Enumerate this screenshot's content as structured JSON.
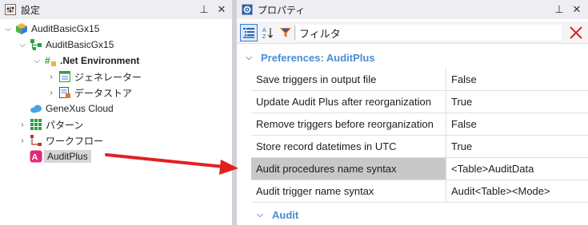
{
  "left_panel": {
    "title": "設定",
    "pin_glyph": "⊥",
    "close_glyph": "✕",
    "tree": [
      {
        "label": "AuditBasicGx15",
        "icon": "knowledge-base-icon",
        "bold": false,
        "expanded": true
      },
      {
        "label": "AuditBasicGx15",
        "icon": "version-icon",
        "bold": false,
        "expanded": true
      },
      {
        "label": ".Net Environment",
        "icon": "environment-icon",
        "bold": true,
        "expanded": true
      },
      {
        "label": "ジェネレーター",
        "icon": "generator-icon",
        "bold": false,
        "expanded": false
      },
      {
        "label": "データストア",
        "icon": "datastore-icon",
        "bold": false,
        "expanded": false
      },
      {
        "label": "GeneXus Cloud",
        "icon": "cloud-icon",
        "bold": false,
        "expanded": null
      },
      {
        "label": "パターン",
        "icon": "patterns-icon",
        "bold": false,
        "expanded": false
      },
      {
        "label": "ワークフロー",
        "icon": "workflow-icon",
        "bold": false,
        "expanded": false
      },
      {
        "label": "AuditPlus",
        "icon": "auditplus-icon",
        "bold": false,
        "expanded": null,
        "selected": true
      }
    ]
  },
  "right_panel": {
    "title": "プロパティ",
    "pin_glyph": "⊥",
    "close_glyph": "✕",
    "filter_label": "フィルタ",
    "group_preferences": "Preferences: AuditPlus",
    "group_audit": "Audit",
    "properties": [
      {
        "name": "Save triggers in output file",
        "value": "False"
      },
      {
        "name": "Update Audit Plus after reorganization",
        "value": "True"
      },
      {
        "name": "Remove triggers before reorganization",
        "value": "False"
      },
      {
        "name": "Store record datetimes in UTC",
        "value": "True"
      },
      {
        "name": "Audit procedures name syntax",
        "value": "<Table>AuditData",
        "selected": true
      },
      {
        "name": "Audit trigger name syntax",
        "value": "Audit<Table><Mode>"
      }
    ]
  },
  "colors": {
    "accent_blue": "#4a8cd6",
    "arrow_red": "#e32020",
    "selected_gray": "#c8c8c8",
    "header_bg": "#eeeef2"
  }
}
